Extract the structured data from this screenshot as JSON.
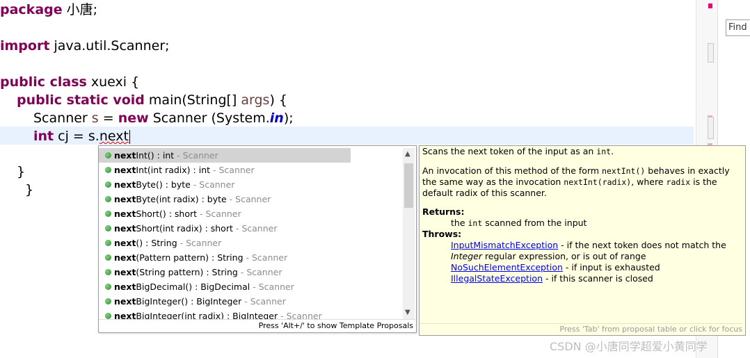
{
  "editor": {
    "line1": {
      "kw": "package",
      "rest": " 小唐;"
    },
    "line2": {
      "kw": "import",
      "rest": " java.util.Scanner;"
    },
    "line3": {
      "kw": "public class",
      "rest": " xuexi {"
    },
    "line4": {
      "kw": "public static void",
      "rest": " main(String[] ",
      "arg": "args",
      "end": ") {"
    },
    "line5": {
      "pre": "Scanner ",
      "var": "s",
      "mid": " = ",
      "kw": "new",
      "post": " Scanner (System.",
      "field": "in",
      "end": ");"
    },
    "line6": {
      "kw": "int",
      "mid": " cj = s.",
      "typed": "next"
    },
    "line7": "}",
    "line8": "}"
  },
  "find": {
    "label": "Find"
  },
  "proposals": {
    "items": [
      {
        "bold": "next",
        "rest": "Int() : int",
        "type": " - Scanner"
      },
      {
        "bold": "next",
        "rest": "Int(int radix) : int",
        "type": " - Scanner"
      },
      {
        "bold": "next",
        "rest": "Byte() : byte",
        "type": " - Scanner"
      },
      {
        "bold": "next",
        "rest": "Byte(int radix) : byte",
        "type": " - Scanner"
      },
      {
        "bold": "next",
        "rest": "Short() : short",
        "type": " - Scanner"
      },
      {
        "bold": "next",
        "rest": "Short(int radix) : short",
        "type": " - Scanner"
      },
      {
        "bold": "next",
        "rest": "() : String",
        "type": " - Scanner"
      },
      {
        "bold": "next",
        "rest": "(Pattern pattern) : String",
        "type": " - Scanner"
      },
      {
        "bold": "next",
        "rest": "(String pattern) : String",
        "type": " - Scanner"
      },
      {
        "bold": "next",
        "rest": "BigDecimal() : BigDecimal",
        "type": " - Scanner"
      },
      {
        "bold": "next",
        "rest": "BigInteger() : BigInteger",
        "type": " - Scanner"
      },
      {
        "bold": "next",
        "rest": "BigInteger(int radix) : BigInteger",
        "type": " - Scanner"
      }
    ],
    "footer": "Press 'Alt+/' to show Template Proposals"
  },
  "doc": {
    "summary_pre": "Scans the next token of the input as an ",
    "summary_code": "int",
    "summary_post": ".",
    "para_1": "An invocation of this method of the form ",
    "para_code1": "nextInt()",
    "para_2": " behaves in exactly the same way as the invocation ",
    "para_code2": "nextInt(radix)",
    "para_3": ", where ",
    "para_code3": "radix",
    "para_4": " is the default radix of this scanner.",
    "returns_label": "Returns:",
    "returns_pre": "the ",
    "returns_code": "int",
    "returns_post": " scanned from the input",
    "throws_label": "Throws:",
    "throws": [
      {
        "link": "InputMismatchException",
        "pre": " - if the next token does not match the ",
        "ital": "Integer",
        "post": " regular expression, or is out of range"
      },
      {
        "link": "NoSuchElementException",
        "pre": " - if input is exhausted",
        "ital": "",
        "post": ""
      },
      {
        "link": "IllegalStateException",
        "pre": " - if this scanner is closed",
        "ital": "",
        "post": ""
      }
    ],
    "footer": "Press 'Tab' from proposal table or click for focus"
  },
  "watermark": "CSDN @小唐同学超爱小黄同学"
}
